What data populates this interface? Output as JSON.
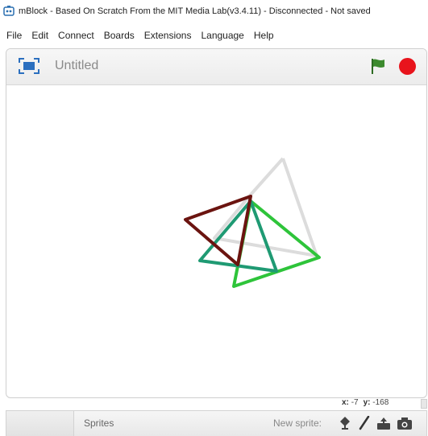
{
  "window": {
    "title": "mBlock - Based On Scratch From the MIT Media Lab(v3.4.11) - Disconnected - Not saved"
  },
  "menu": {
    "items": [
      "File",
      "Edit",
      "Connect",
      "Boards",
      "Extensions",
      "Language",
      "Help"
    ]
  },
  "stage": {
    "project_title": "Untitled",
    "flag_color": "#3c8a2e",
    "stop_color": "#e8141c",
    "drawing": {
      "shapes": [
        {
          "name": "light-gray-triangle",
          "color": "#dcdcdc"
        },
        {
          "name": "dark-red-triangle",
          "color": "#6b1410"
        },
        {
          "name": "teal-triangle",
          "color": "#1f9a73"
        },
        {
          "name": "bright-green-triangle",
          "color": "#2ec43a"
        }
      ]
    }
  },
  "coords": {
    "x_label": "x:",
    "x_value": "-7",
    "y_label": "y:",
    "y_value": "-168"
  },
  "bottom_bar": {
    "sprites_label": "Sprites",
    "new_sprite_label": "New sprite:",
    "new_sprite_icons": [
      "choose-sprite-from-library-icon",
      "paint-new-sprite-icon",
      "upload-sprite-icon",
      "camera-icon"
    ]
  }
}
